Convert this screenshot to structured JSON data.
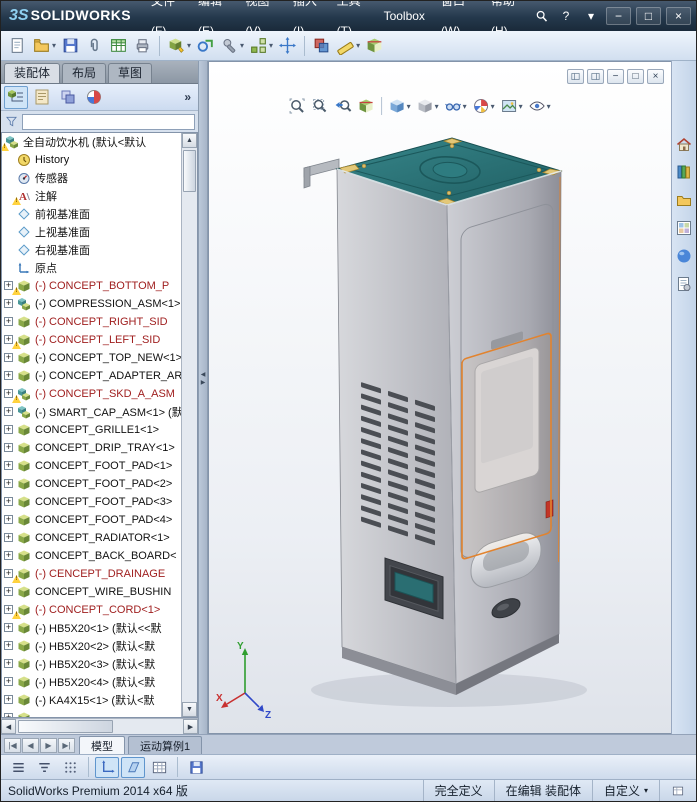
{
  "titlebar": {
    "logo_mark": "3S",
    "logo_text": "SOLIDWORKS",
    "menus": [
      "文件(F)",
      "编辑(E)",
      "视图(V)",
      "插入(I)",
      "工具(T)",
      "Toolbox",
      "窗口(W)",
      "帮助(H)"
    ],
    "help_glyph": "?",
    "search_dropdown_glyph": "▾",
    "window_buttons": [
      "−",
      "□",
      "×"
    ]
  },
  "toolbar": {
    "buttons": [
      {
        "n": "new-document"
      },
      {
        "n": "open",
        "dd": true
      },
      {
        "n": "save"
      },
      {
        "n": "attach"
      },
      {
        "n": "design-table"
      },
      {
        "n": "print"
      },
      {
        "sep": true
      },
      {
        "n": "insert-component",
        "dd": true
      },
      {
        "n": "mate"
      },
      {
        "n": "smart-fasteners",
        "dd": true
      },
      {
        "n": "linear-pattern",
        "dd": true
      },
      {
        "n": "move-component"
      },
      {
        "sep": true
      },
      {
        "n": "interference"
      },
      {
        "n": "measure",
        "dd": true
      },
      {
        "n": "section-view"
      }
    ]
  },
  "panel": {
    "tabs": [
      {
        "label": "装配体",
        "active": true
      },
      {
        "label": "布局",
        "active": false
      },
      {
        "label": "草图",
        "active": false
      }
    ],
    "manager_tabs": [
      "featuremanager",
      "propertymanager",
      "configurationmanager",
      "displaymanager"
    ],
    "chevron": "»"
  },
  "tree": {
    "root": "全自动饮水机 (默认<默认",
    "items": [
      {
        "l": "History",
        "i": "history"
      },
      {
        "l": "传感器",
        "i": "sensor"
      },
      {
        "l": "注解",
        "i": "annot",
        "w": true
      },
      {
        "l": "前视基准面",
        "i": "plane"
      },
      {
        "l": "上视基准面",
        "i": "plane"
      },
      {
        "l": "右视基准面",
        "i": "plane"
      },
      {
        "l": "原点",
        "i": "origin"
      },
      {
        "l": "(-) CONCEPT_BOTTOM_P",
        "i": "part",
        "c": "r",
        "w": true,
        "e": true
      },
      {
        "l": "(-) COMPRESSION_ASM<1>",
        "i": "asm",
        "e": true
      },
      {
        "l": "(-) CONCEPT_RIGHT_SID",
        "i": "part",
        "c": "r",
        "e": true
      },
      {
        "l": "(-) CONCEPT_LEFT_SID",
        "i": "part",
        "c": "r",
        "w": true,
        "e": true
      },
      {
        "l": "(-) CONCEPT_TOP_NEW<1>",
        "i": "part",
        "e": true
      },
      {
        "l": "(-) CONCEPT_ADAPTER_ARO",
        "i": "part",
        "e": true
      },
      {
        "l": "(-) CONCEPT_SKD_A_ASM",
        "i": "asm",
        "c": "r",
        "w": true,
        "e": true
      },
      {
        "l": "(-) SMART_CAP_ASM<1> (默",
        "i": "asm",
        "e": true
      },
      {
        "l": "CONCEPT_GRILLE1<1>",
        "i": "part",
        "e": true
      },
      {
        "l": "CONCEPT_DRIP_TRAY<1>",
        "i": "part",
        "e": true
      },
      {
        "l": "CONCEPT_FOOT_PAD<1>",
        "i": "part",
        "e": true
      },
      {
        "l": "CONCEPT_FOOT_PAD<2>",
        "i": "part",
        "e": true
      },
      {
        "l": "CONCEPT_FOOT_PAD<3>",
        "i": "part",
        "e": true
      },
      {
        "l": "CONCEPT_FOOT_PAD<4>",
        "i": "part",
        "e": true
      },
      {
        "l": "CONCEPT_RADIATOR<1>",
        "i": "part",
        "e": true
      },
      {
        "l": "CONCEPT_BACK_BOARD<",
        "i": "part",
        "e": true
      },
      {
        "l": "(-) CENCEPT_DRAINAGE",
        "i": "part",
        "c": "r",
        "w": true,
        "e": true
      },
      {
        "l": "CONCEPT_WIRE_BUSHIN",
        "i": "part",
        "e": true
      },
      {
        "l": "(-) CONCEPT_CORD<1>",
        "i": "part",
        "c": "r",
        "w": true,
        "e": true
      },
      {
        "l": "(-) HB5X20<1> (默认<<默",
        "i": "part",
        "e": true
      },
      {
        "l": "(-) HB5X20<2> (默认<默",
        "i": "part",
        "e": true
      },
      {
        "l": "(-) HB5X20<3> (默认<默",
        "i": "part",
        "e": true
      },
      {
        "l": "(-) HB5X20<4> (默认<默",
        "i": "part",
        "e": true
      },
      {
        "l": "(-) KA4X15<1> (默认<默",
        "i": "part",
        "e": true
      },
      {
        "l": "",
        "i": "part",
        "e": true
      }
    ]
  },
  "viewport": {
    "headsup": [
      {
        "n": "zoom-fit"
      },
      {
        "n": "zoom-area"
      },
      {
        "n": "previous-view"
      },
      {
        "n": "section-view-hud"
      },
      {
        "sep": true
      },
      {
        "n": "view-orientation",
        "dd": true
      },
      {
        "n": "display-style",
        "dd": true
      },
      {
        "n": "hide-show",
        "dd": true
      },
      {
        "n": "edit-appearance",
        "dd": true
      },
      {
        "n": "apply-scene",
        "dd": true
      },
      {
        "n": "view-settings",
        "dd": true
      }
    ],
    "window_buttons": [
      "−",
      "□",
      "×"
    ],
    "triad": {
      "x": "X",
      "y": "Y",
      "z": "Z"
    }
  },
  "taskpane": {
    "buttons": [
      "solidworks-resources",
      "design-library",
      "file-explorer",
      "view-palette",
      "appearances-scenes",
      "custom-properties"
    ]
  },
  "bottom": {
    "nav": [
      "|◀",
      "◀",
      "▶",
      "▶|"
    ],
    "tabs": [
      {
        "label": "模型",
        "active": true
      },
      {
        "label": "运动算例1",
        "active": false
      }
    ],
    "toolbar": [
      {
        "n": "menu-lines"
      },
      {
        "n": "filter-lines"
      },
      {
        "n": "grid-dots"
      },
      {
        "sep": true
      },
      {
        "n": "sketch-axes",
        "pressed": true
      },
      {
        "n": "sketch-plane",
        "pressed": true
      },
      {
        "n": "table-grid"
      },
      {
        "sep": true
      },
      {
        "n": "save-blue"
      }
    ]
  },
  "statusbar": {
    "left": "SolidWorks Premium 2014 x64 版",
    "defined": "完全定义",
    "editing": "在编辑 装配体",
    "custom": "自定义",
    "dropdown_glyph": "▾"
  }
}
